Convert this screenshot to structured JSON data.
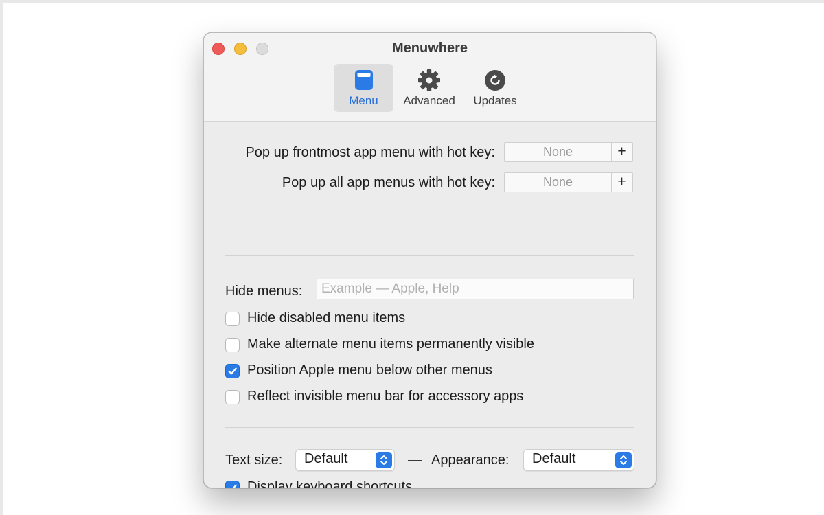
{
  "window": {
    "title": "Menuwhere"
  },
  "toolbar": {
    "tabs": [
      {
        "label": "Menu",
        "icon": "menu-window-icon",
        "selected": true
      },
      {
        "label": "Advanced",
        "icon": "gear-icon",
        "selected": false
      },
      {
        "label": "Updates",
        "icon": "refresh-icon",
        "selected": false
      }
    ]
  },
  "hotkeys": {
    "frontmost_label": "Pop up frontmost app menu with hot key:",
    "frontmost_value": "None",
    "all_label": "Pop up all app menus with hot key:",
    "all_value": "None",
    "add_symbol": "+"
  },
  "hide_menus": {
    "label": "Hide menus:",
    "value": "",
    "placeholder": "Example — Apple, Help"
  },
  "options": [
    {
      "label": "Hide disabled menu items",
      "checked": false
    },
    {
      "label": "Make alternate menu items permanently visible",
      "checked": false
    },
    {
      "label": "Position Apple menu below other menus",
      "checked": true
    },
    {
      "label": "Reflect invisible menu bar for accessory apps",
      "checked": false
    }
  ],
  "appearance": {
    "text_size_label": "Text size:",
    "text_size_value": "Default",
    "separator": "—",
    "appearance_label": "Appearance:",
    "appearance_value": "Default"
  },
  "shortcuts": {
    "label": "Display keyboard shortcuts",
    "checked": true
  },
  "colors": {
    "accent": "#2a7be6",
    "close": "#ee5b58",
    "minimize": "#f5bd3e"
  }
}
